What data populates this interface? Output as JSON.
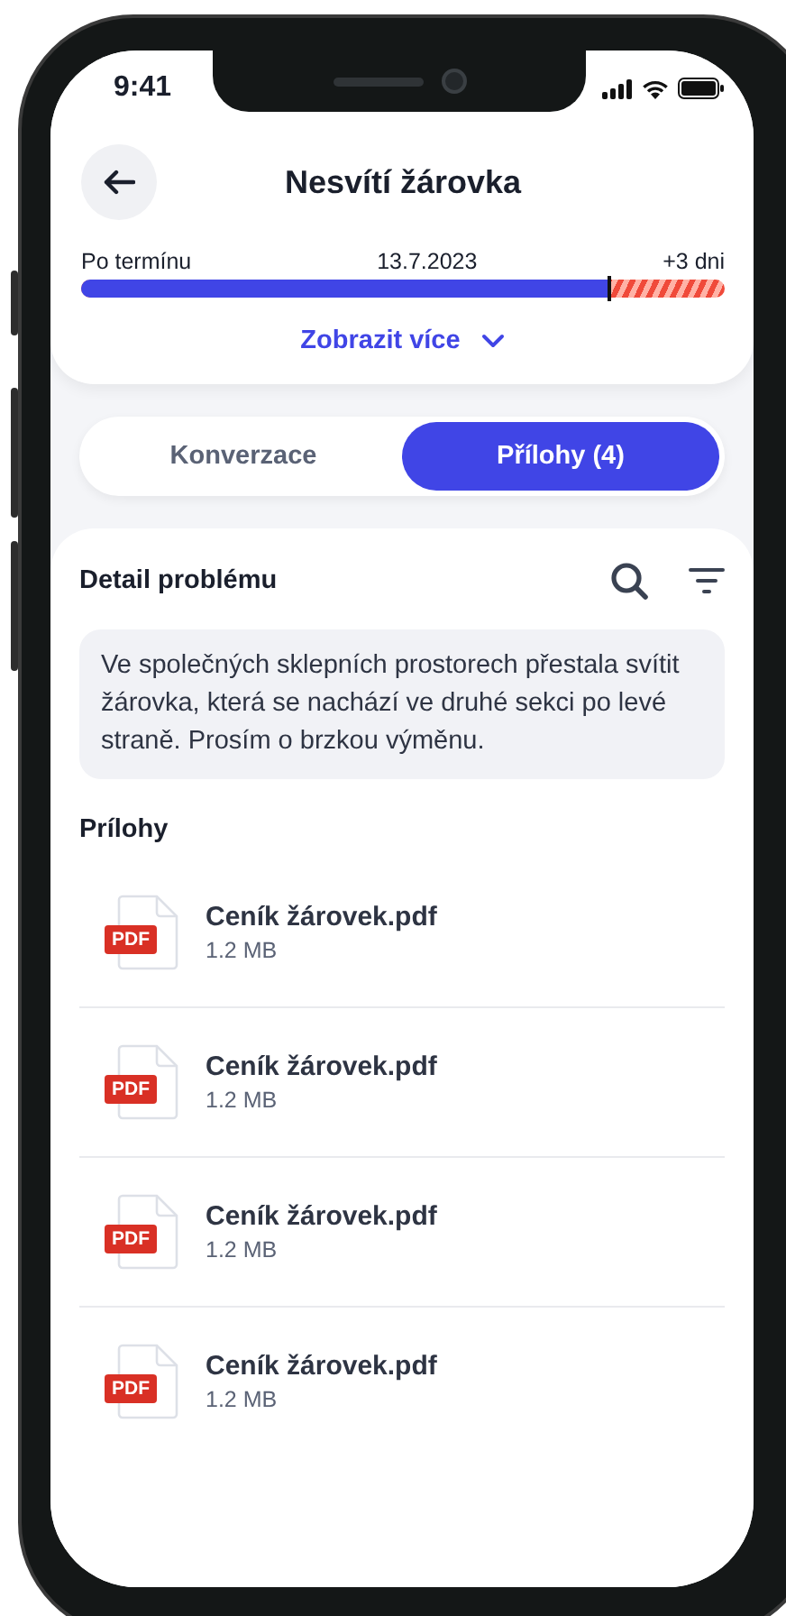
{
  "status_bar": {
    "time": "9:41"
  },
  "header": {
    "title": "Nesvítí žárovka"
  },
  "deadline": {
    "status": "Po termínu",
    "date": "13.7.2023",
    "overdue": "+3 dni",
    "level": 0.82
  },
  "show_more": "Zobrazit více",
  "tabs": [
    {
      "label": "Konverzace",
      "selected": false
    },
    {
      "label": "Přílohy (4)",
      "selected": true
    }
  ],
  "detail": {
    "title": "Detail problému",
    "message": "Ve společných sklepních prostorech přestala svítit žárovka, která se nachází ve druhé sekci po levé straně. Prosím o brzkou výměnu."
  },
  "attachments": {
    "title": "Prílohy",
    "files": [
      {
        "name": "Ceník žárovek.pdf",
        "size": "1.2 MB",
        "type": "PDF"
      },
      {
        "name": "Ceník žárovek.pdf",
        "size": "1.2 MB",
        "type": "PDF"
      },
      {
        "name": "Ceník žárovek.pdf",
        "size": "1.2 MB",
        "type": "PDF"
      },
      {
        "name": "Ceník žárovek.pdf",
        "size": "1.2 MB",
        "type": "PDF"
      }
    ]
  }
}
